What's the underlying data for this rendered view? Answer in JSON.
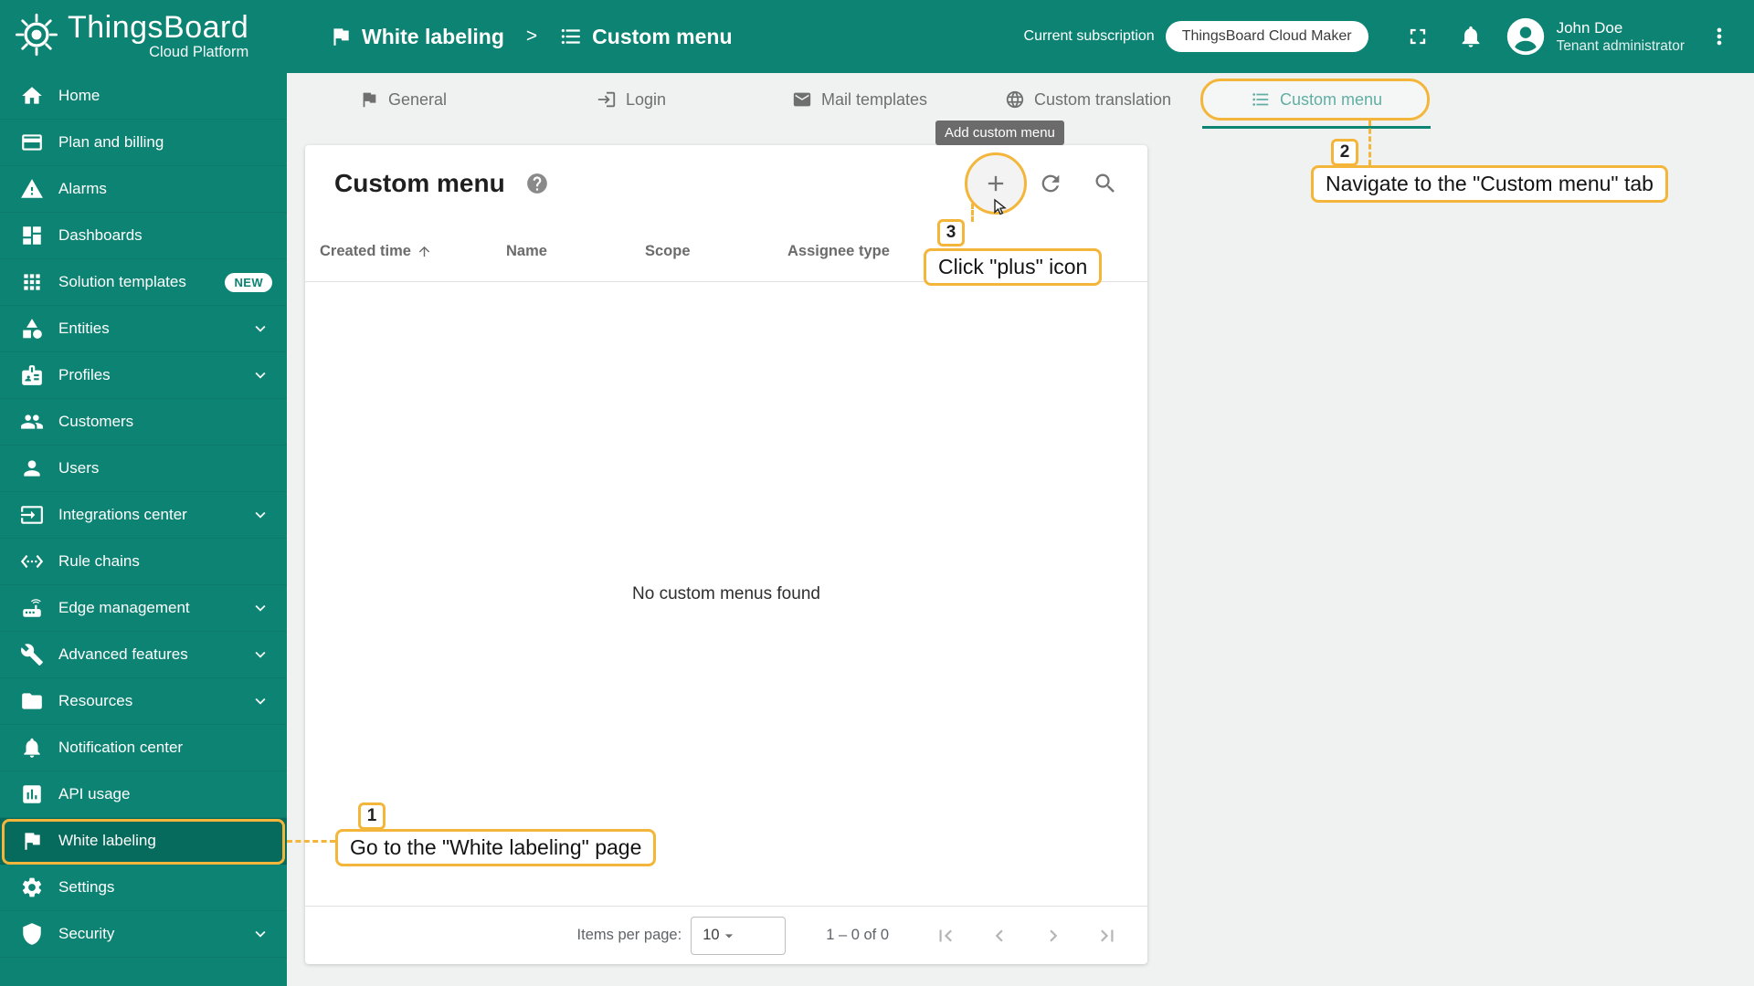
{
  "colors": {
    "primary": "#0d8373",
    "accent": "#f4b63a"
  },
  "app": {
    "name": "ThingsBoard",
    "tagline": "Cloud Platform"
  },
  "topbar": {
    "breadcrumb": {
      "parent": "White labeling",
      "separator": ">",
      "current": "Custom menu"
    },
    "subscription_label": "Current subscription",
    "subscription_plan": "ThingsBoard Cloud Maker",
    "user_name": "John Doe",
    "user_role": "Tenant administrator"
  },
  "sidebar": {
    "items": [
      {
        "label": "Home",
        "icon": "home-icon"
      },
      {
        "label": "Plan and billing",
        "icon": "credit-card-icon"
      },
      {
        "label": "Alarms",
        "icon": "warning-icon"
      },
      {
        "label": "Dashboards",
        "icon": "dashboard-icon"
      },
      {
        "label": "Solution templates",
        "icon": "apps-icon",
        "badge": "NEW"
      },
      {
        "label": "Entities",
        "icon": "category-icon",
        "expandable": true
      },
      {
        "label": "Profiles",
        "icon": "badge-icon",
        "expandable": true
      },
      {
        "label": "Customers",
        "icon": "people-icon"
      },
      {
        "label": "Users",
        "icon": "person-icon"
      },
      {
        "label": "Integrations center",
        "icon": "input-icon",
        "expandable": true
      },
      {
        "label": "Rule chains",
        "icon": "rule-chain-icon"
      },
      {
        "label": "Edge management",
        "icon": "router-icon",
        "expandable": true
      },
      {
        "label": "Advanced features",
        "icon": "tools-icon",
        "expandable": true
      },
      {
        "label": "Resources",
        "icon": "folder-icon",
        "expandable": true
      },
      {
        "label": "Notification center",
        "icon": "bell-icon"
      },
      {
        "label": "API usage",
        "icon": "chart-icon"
      },
      {
        "label": "White labeling",
        "icon": "flag-icon",
        "active": true
      },
      {
        "label": "Settings",
        "icon": "gear-icon"
      },
      {
        "label": "Security",
        "icon": "shield-icon",
        "expandable": true
      }
    ]
  },
  "tabs": [
    {
      "label": "General",
      "icon": "flag-icon"
    },
    {
      "label": "Login",
      "icon": "login-icon"
    },
    {
      "label": "Mail templates",
      "icon": "mail-icon"
    },
    {
      "label": "Custom translation",
      "icon": "globe-icon"
    },
    {
      "label": "Custom menu",
      "icon": "list-icon",
      "active": true
    }
  ],
  "page": {
    "title": "Custom menu",
    "table": {
      "columns": [
        "Created time",
        "Name",
        "Scope",
        "Assignee type"
      ],
      "empty_message": "No custom menus found"
    },
    "footer": {
      "items_per_page_label": "Items per page:",
      "items_per_page_value": "10",
      "range_label": "1 – 0 of 0"
    }
  },
  "tooltip": {
    "add_custom_menu": "Add custom menu"
  },
  "annotations": {
    "step1": {
      "number": "1",
      "text": "Go to the \"White labeling\" page"
    },
    "step2": {
      "number": "2",
      "text": "Navigate to the \"Custom menu\" tab"
    },
    "step3": {
      "number": "3",
      "text": "Click \"plus\" icon"
    }
  }
}
